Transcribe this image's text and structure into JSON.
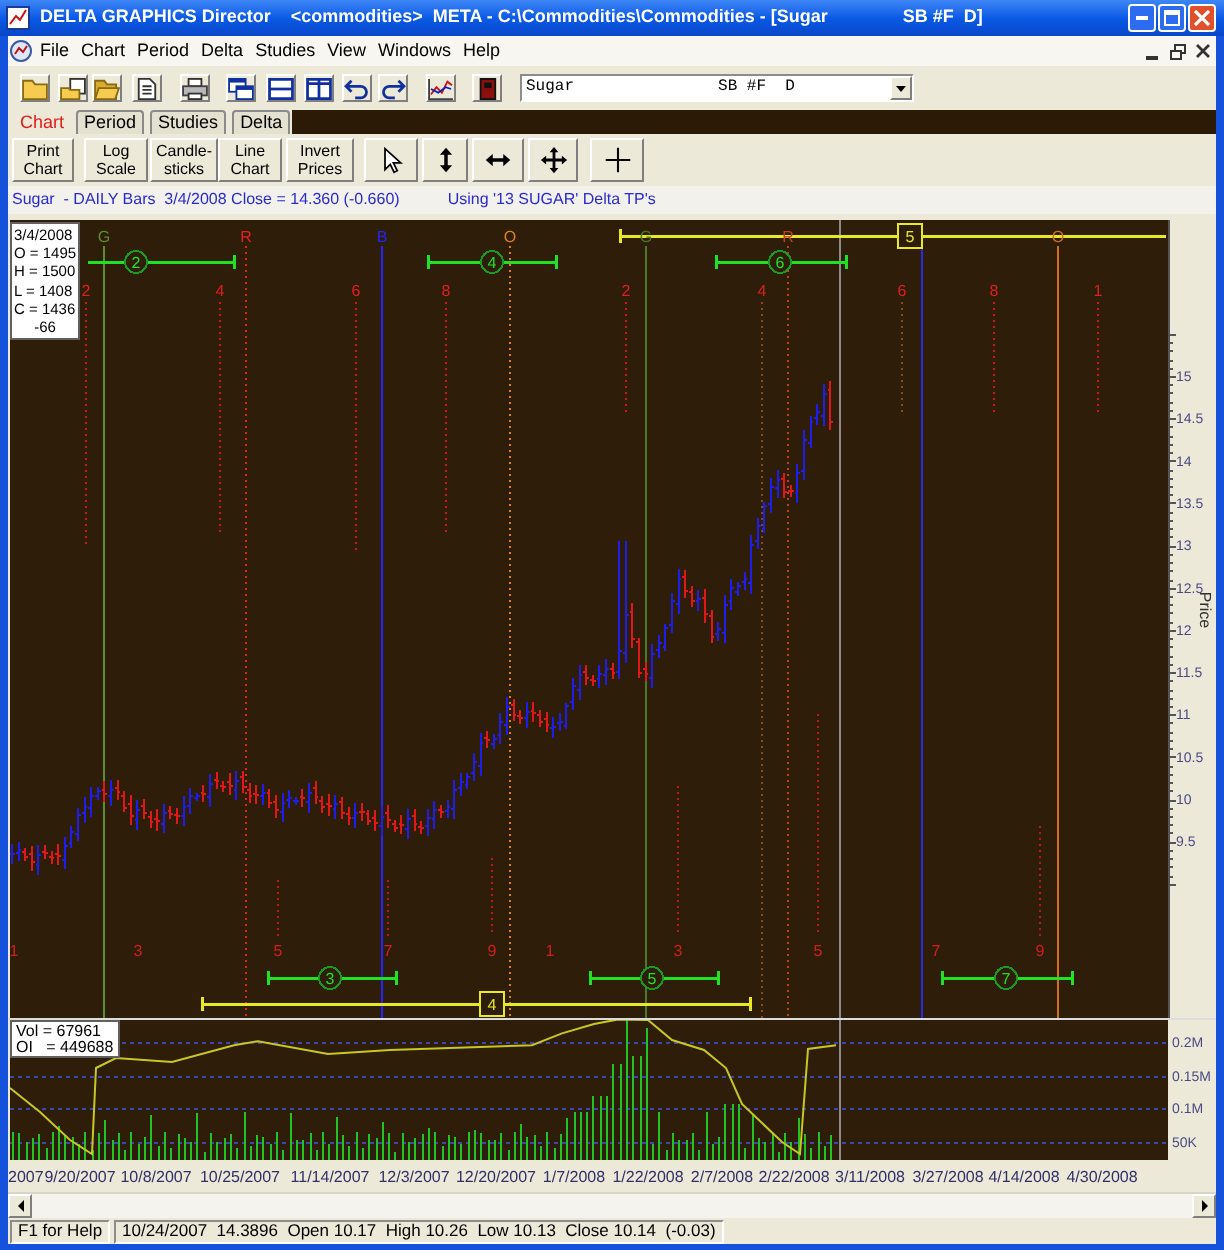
{
  "window": {
    "title": "DELTA GRAPHICS Director    <commodities>  META - C:\\Commodities\\Commodities - [Sugar               SB #F  D]"
  },
  "menu": [
    "File",
    "Chart",
    "Period",
    "Delta",
    "Studies",
    "View",
    "Windows",
    "Help"
  ],
  "symbol_select": {
    "value": "Sugar               SB #F  D"
  },
  "tabs": [
    {
      "label": "Chart",
      "selected": true
    },
    {
      "label": "Period",
      "selected": false
    },
    {
      "label": "Studies",
      "selected": false
    },
    {
      "label": "Delta",
      "selected": false
    }
  ],
  "chart_buttons": [
    "Print Chart",
    "Log Scale",
    "Candle-sticks",
    "Line Chart",
    "Invert Prices"
  ],
  "chart_header": {
    "summary": "Sugar  - DAILY Bars  3/4/2008 Close = 14.360 (-0.660)",
    "template": "Using '13 SUGAR' Delta TP's"
  },
  "price_chart": {
    "readout": [
      "3/4/2008",
      "O = 1495",
      "H = 1500",
      "L = 1408",
      "C = 1436",
      "-66"
    ],
    "top_markers": [
      {
        "label": "G",
        "color": "#5a8f2a"
      },
      {
        "label": "R",
        "color": "#e82020"
      },
      {
        "label": "B",
        "color": "#2424ff"
      },
      {
        "label": "O",
        "color": "#e0801e"
      },
      {
        "label": "G",
        "color": "#4a7a2a"
      },
      {
        "label": "R",
        "color": "#c04020"
      },
      {
        "label": "O",
        "color": "#d07020"
      }
    ],
    "top_numbers": [
      "2",
      "4",
      "6",
      "8",
      "2",
      "4",
      "6",
      "8",
      "1"
    ],
    "top_ranges": [
      {
        "label": "2",
        "kind": "circled"
      },
      {
        "label": "4",
        "kind": "circled"
      },
      {
        "label": "6",
        "kind": "circled"
      },
      {
        "label": "5",
        "kind": "boxed"
      }
    ],
    "bottom_numbers": [
      "1",
      "3",
      "5",
      "7",
      "9",
      "1",
      "3",
      "5",
      "7",
      "9"
    ],
    "bottom_ranges": [
      {
        "label": "3",
        "kind": "circled"
      },
      {
        "label": "5",
        "kind": "circled"
      },
      {
        "label": "7",
        "kind": "circled"
      },
      {
        "label": "4",
        "kind": "boxed"
      }
    ],
    "axis_labels": [
      "15",
      "14.5",
      "14",
      "13.5",
      "13",
      "12.5",
      "12",
      "11.5",
      "11",
      "10.5",
      "10",
      "9.5"
    ],
    "axis_title": "Price"
  },
  "volume_chart": {
    "readout": [
      "Vol = 67961",
      "OI   = 449688"
    ],
    "axis_labels": [
      "0.2M",
      "0.15M",
      "0.1M",
      "50K"
    ]
  },
  "date_axis": [
    "2007",
    "9/20/2007",
    "10/8/2007",
    "10/25/2007",
    "11/14/2007",
    "12/3/2007",
    "12/20/2007",
    "1/7/2008",
    "1/22/2008",
    "2/7/2008",
    "2/22/2008",
    "3/11/2008",
    "3/27/2008",
    "4/14/2008",
    "4/30/2008"
  ],
  "status_bar": [
    "F1 for Help",
    "10/24/2007  14.3896  Open 10.17  High 10.26  Low 10.13  Close 10.14  (-0.03)"
  ]
}
